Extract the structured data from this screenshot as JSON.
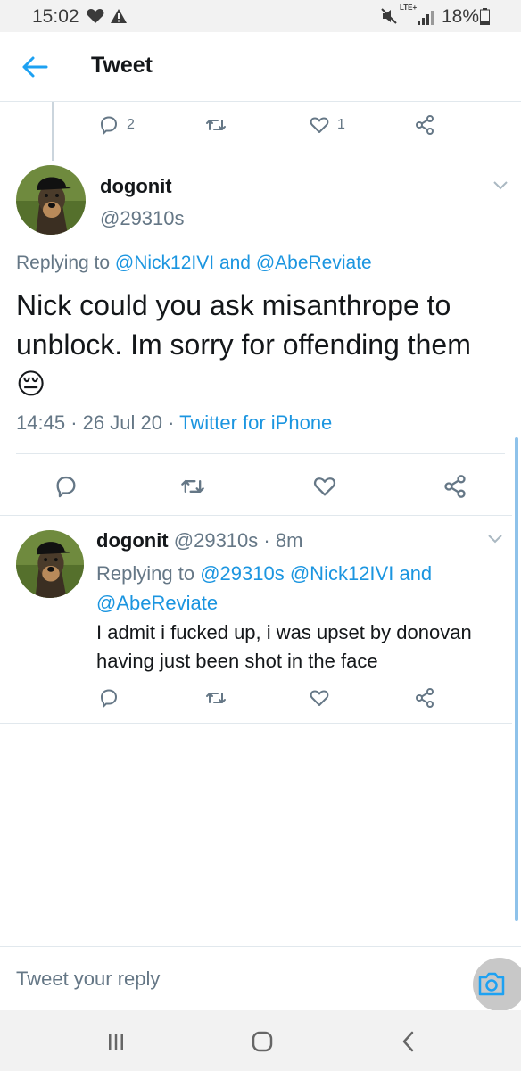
{
  "status_bar": {
    "time": "15:02",
    "network": "LTE+",
    "battery": "18%",
    "icons": [
      "heart-icon",
      "warning-icon",
      "mute-icon",
      "signal-icon",
      "battery-icon"
    ]
  },
  "header": {
    "title": "Tweet",
    "back_icon": "arrow-left-icon"
  },
  "parent_actions": {
    "reply_count": "2",
    "retweet_count": "",
    "like_count": "1"
  },
  "main_tweet": {
    "name": "dogonit",
    "handle": "@29310s",
    "replying_prefix": "Replying to",
    "replying_user1": "@Nick12IVI",
    "replying_and": "and",
    "replying_user2": "@AbeReviate",
    "text": "Nick could you ask misanthrope to unblock. Im sorry for offending them",
    "emoji": "😔",
    "time": "14:45",
    "separator": "·",
    "date": "26 Jul 20",
    "source": "Twitter for iPhone"
  },
  "reply_tweet": {
    "name": "dogonit",
    "handle": "@29310s",
    "separator": "·",
    "age": "8m",
    "replying_prefix": "Replying to",
    "replying_user1": "@29310s",
    "replying_user2": "@Nick12IVI",
    "replying_and": "and",
    "replying_user3": "@AbeReviate",
    "text": "I admit i fucked up, i was upset by donovan having just been shot in the face"
  },
  "compose": {
    "placeholder": "Tweet your reply",
    "camera_icon": "camera-icon"
  },
  "colors": {
    "link": "#1b95e0",
    "secondary_text": "#657786",
    "primary_text": "#14171a",
    "divider": "#e1e8ed"
  }
}
